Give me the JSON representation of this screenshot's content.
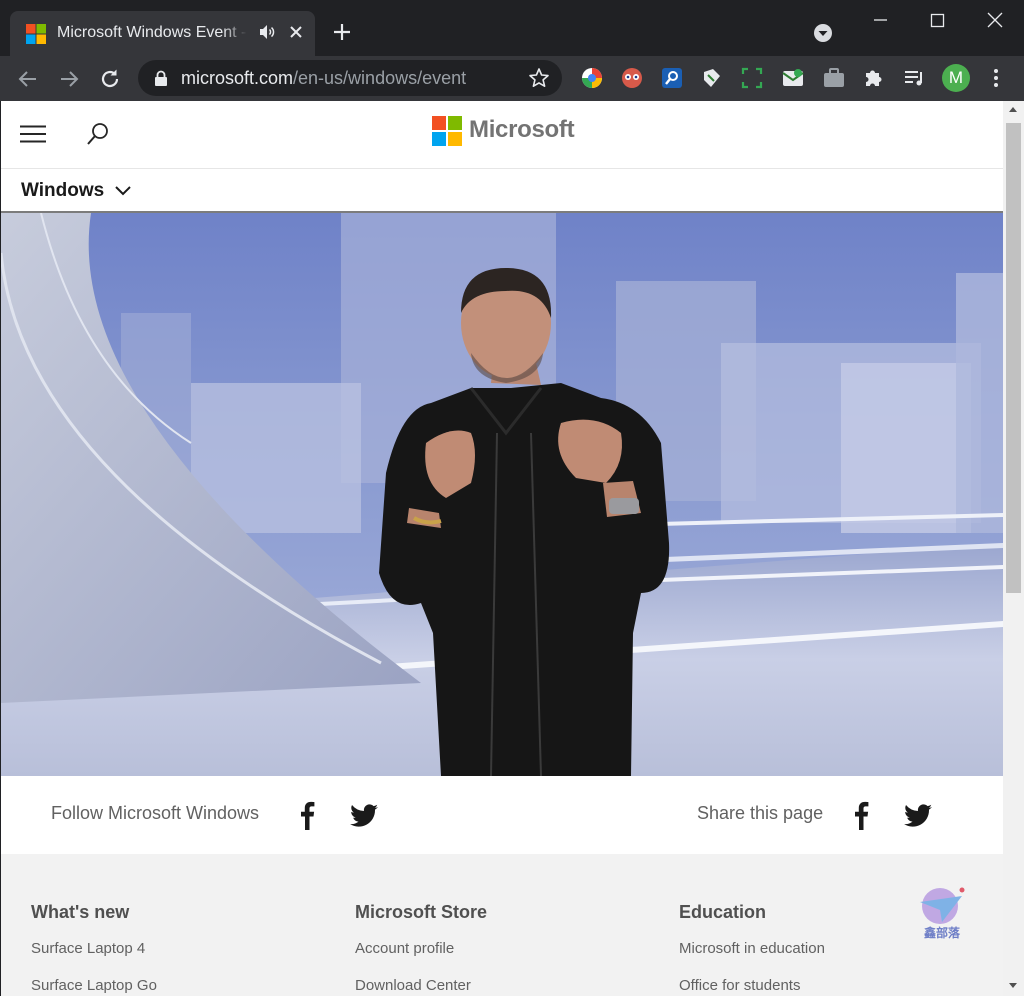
{
  "browser": {
    "tab_title": "Microsoft Windows Event -",
    "url_host": "microsoft.com",
    "url_path": "/en-us/windows/event",
    "profile_initial": "M",
    "extensions": [
      "color-picker-icon",
      "reader-icon",
      "search-ext-icon",
      "translate-icon",
      "screenshot-icon",
      "mail-check-icon",
      "briefcase-icon",
      "puzzle-icon",
      "playlist-icon"
    ]
  },
  "site": {
    "brand": "Microsoft",
    "subnav_title": "Windows"
  },
  "follow": {
    "follow_label": "Follow Microsoft Windows",
    "share_label": "Share this page"
  },
  "footer": {
    "columns": [
      {
        "heading": "What's new",
        "links": [
          "Surface Laptop 4",
          "Surface Laptop Go"
        ]
      },
      {
        "heading": "Microsoft Store",
        "links": [
          "Account profile",
          "Download Center"
        ]
      },
      {
        "heading": "Education",
        "links": [
          "Microsoft in education",
          "Office for students"
        ]
      }
    ],
    "watermark": "鑫部落"
  },
  "colors": {
    "ms_red": "#f25022",
    "ms_green": "#7fba00",
    "ms_blue": "#00a4ef",
    "ms_yellow": "#ffb900",
    "avatar_green": "#4caf50"
  }
}
